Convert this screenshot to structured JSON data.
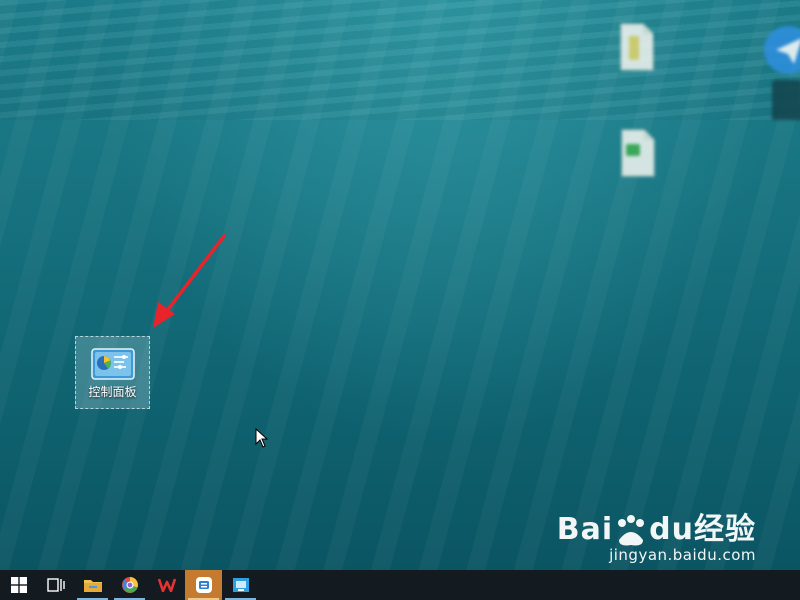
{
  "desktop": {
    "icons": [
      {
        "label": "控制面板",
        "icon": "control-panel-icon",
        "selected": true
      },
      {
        "label": "",
        "icon": "document-icon",
        "blurred": true
      },
      {
        "label": "",
        "icon": "spreadsheet-document-icon",
        "blurred": true
      },
      {
        "label": "",
        "icon": "send-app-icon",
        "blurred": true
      }
    ],
    "annotation": {
      "icon": "red-arrow-icon",
      "color": "#e8232a"
    }
  },
  "watermark": {
    "brand_left": "Bai",
    "brand_mid": "du",
    "brand_right": "经验",
    "site": "jingyan.baidu.com"
  },
  "taskbar": {
    "items": [
      {
        "icon": "windows-start-icon"
      },
      {
        "icon": "task-view-icon"
      },
      {
        "icon": "file-explorer-icon",
        "running": true
      },
      {
        "icon": "browser-icon",
        "running": true
      },
      {
        "icon": "wps-office-icon"
      },
      {
        "icon": "app-window-icon",
        "running": true,
        "active": true
      },
      {
        "icon": "image-viewer-icon",
        "running": true
      }
    ]
  },
  "colors": {
    "taskbar_bg": "#141b20",
    "desktop_bg": "#17727f",
    "arrow": "#e8232a",
    "active_task": "#c47a2f"
  }
}
